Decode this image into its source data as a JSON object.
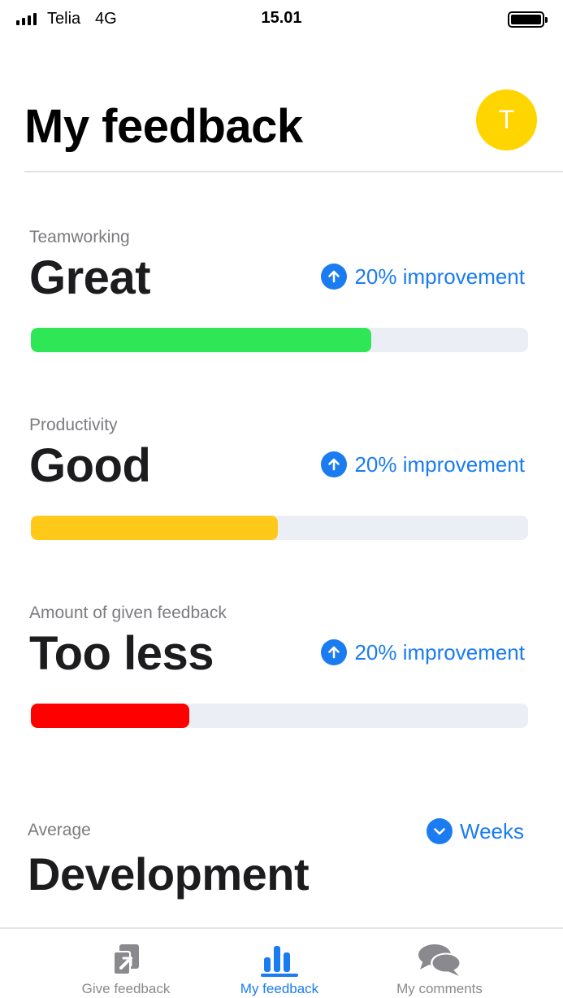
{
  "status_bar": {
    "carrier": "Telia",
    "network": "4G",
    "time": "15.01"
  },
  "header": {
    "title": "My feedback",
    "avatar_initial": "T",
    "avatar_color": "#ffd500"
  },
  "metrics": [
    {
      "label": "Teamworking",
      "value": "Great",
      "trend": "20% improvement",
      "trend_icon": "arrow-up-circle-icon",
      "progress": 0.685,
      "color": "#2fe756"
    },
    {
      "label": "Productivity",
      "value": "Good",
      "trend": "20% improvement",
      "trend_icon": "arrow-up-circle-icon",
      "progress": 0.496,
      "color": "#ffc91a"
    },
    {
      "label": "Amount of given feedback",
      "value": "Too less",
      "trend": "20% improvement",
      "trend_icon": "arrow-up-circle-icon",
      "progress": 0.319,
      "color": "#ff0000"
    }
  ],
  "average": {
    "label": "Average",
    "value": "Development",
    "period": "Weeks",
    "period_icon": "chevron-down-circle-icon"
  },
  "tab_bar": {
    "active": "my-feedback",
    "items": [
      {
        "id": "give-feedback",
        "label": "Give feedback",
        "icon": "give-feedback-icon"
      },
      {
        "id": "my-feedback",
        "label": "My feedback",
        "icon": "bar-chart-icon"
      },
      {
        "id": "my-comments",
        "label": "My comments",
        "icon": "comments-icon"
      }
    ]
  },
  "colors": {
    "accent": "#1a7cf0",
    "track": "#eceef6"
  }
}
